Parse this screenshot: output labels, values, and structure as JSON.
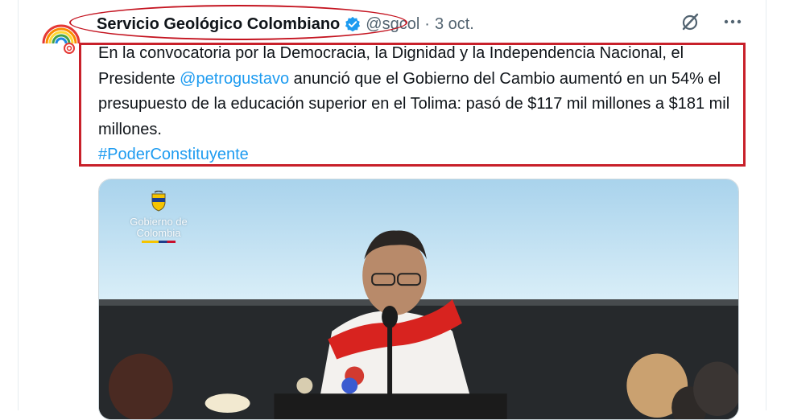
{
  "tweet": {
    "author_name": "Servicio Geológico Colombiano",
    "handle": "@sgcol",
    "separator": "·",
    "date": "3 oct.",
    "text_part1": "En la convocatoria por la Democracia, la Dignidad y la Independencia Nacional, el Presidente ",
    "mention": "@petrogustavo",
    "text_part2": " anunció que el Gobierno del Cambio aumentó en un 54% el presupuesto de la educación superior en el Tolima: pasó de $117 mil millones a $181 mil millones.",
    "hashtag": "#PoderConstituyente"
  },
  "media": {
    "logo_line1": "Gobierno de",
    "logo_line2": "Colombia"
  },
  "icons": {
    "avatar": "sgc-rainbow-logo",
    "verified": "verified-badge-icon",
    "grok": "grok-icon",
    "more": "more-icon"
  },
  "colors": {
    "link": "#1d9bf0",
    "highlight": "#c8202a",
    "text": "#0f1419",
    "muted": "#536471"
  }
}
